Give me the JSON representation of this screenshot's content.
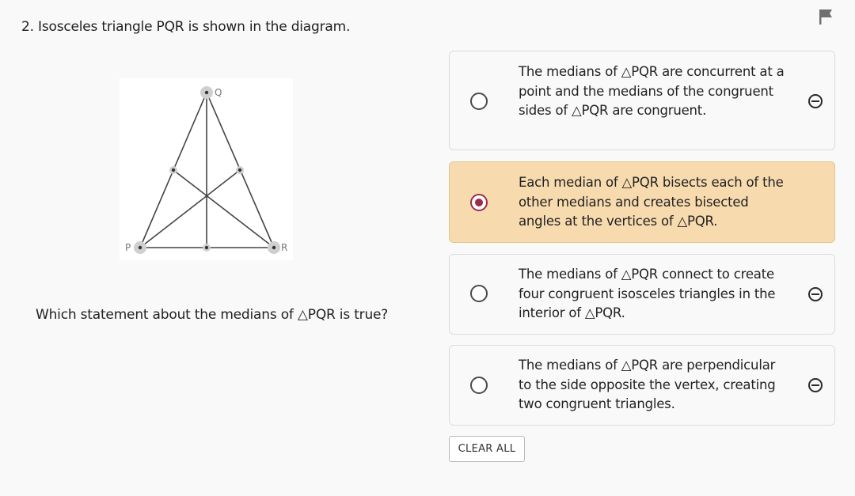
{
  "question": {
    "title": "2. Isosceles triangle PQR is shown in the diagram.",
    "prompt": "Which statement about the medians of △PQR is true?"
  },
  "figure": {
    "vertex_labels": {
      "p": "P",
      "q": "Q",
      "r": "R"
    }
  },
  "choices": [
    {
      "text": "The medians of △PQR are concurrent at a point and the medians of the congruent sides of △PQR are congruent.",
      "selected": false
    },
    {
      "text": "Each median of △PQR bisects each of the other medians and creates bisected angles at the vertices of △PQR.",
      "selected": true
    },
    {
      "text": "The medians of △PQR connect to create four congruent isosceles triangles in the interior of △PQR.",
      "selected": false
    },
    {
      "text": "The medians of △PQR are perpendicular to the side opposite the vertex, creating two congruent triangles.",
      "selected": false
    }
  ],
  "controls": {
    "clear_all_label": "CLEAR ALL"
  },
  "icons": {
    "flag": "flag-icon",
    "eliminate": "eliminate-option-icon"
  },
  "colors": {
    "selected_background": "#f7dbaf",
    "selected_radio": "#9b2d4a"
  }
}
